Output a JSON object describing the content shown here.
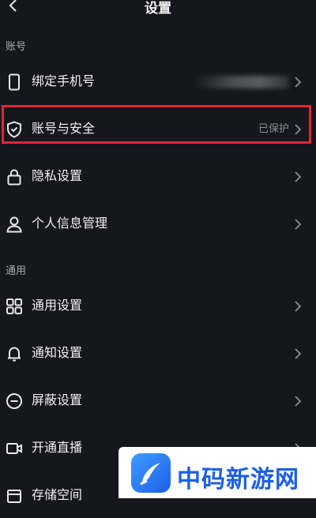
{
  "header": {
    "title": "设置",
    "back_icon": "chevron-left-icon"
  },
  "sections": {
    "account": "账号",
    "general": "通用"
  },
  "rows": [
    {
      "label": "绑定手机号",
      "value": "",
      "icon": "phone-icon"
    },
    {
      "label": "账号与安全",
      "value": "已保护",
      "icon": "shield-icon"
    },
    {
      "label": "隐私设置",
      "value": "",
      "icon": "lock-icon"
    },
    {
      "label": "个人信息管理",
      "value": "",
      "icon": "person-icon"
    },
    {
      "label": "通用设置",
      "value": "",
      "icon": "grid-icon"
    },
    {
      "label": "通知设置",
      "value": "",
      "icon": "bell-icon"
    },
    {
      "label": "屏蔽设置",
      "value": "",
      "icon": "block-icon"
    },
    {
      "label": "开通直播",
      "value": "",
      "icon": "video-icon"
    },
    {
      "label": "存储空间",
      "value": "",
      "icon": "storage-icon"
    }
  ],
  "watermark": {
    "text": "中码新游网"
  },
  "colors": {
    "background": "#16161e",
    "highlight": "#e3262f",
    "watermark_blue": "#1c5fe6"
  }
}
